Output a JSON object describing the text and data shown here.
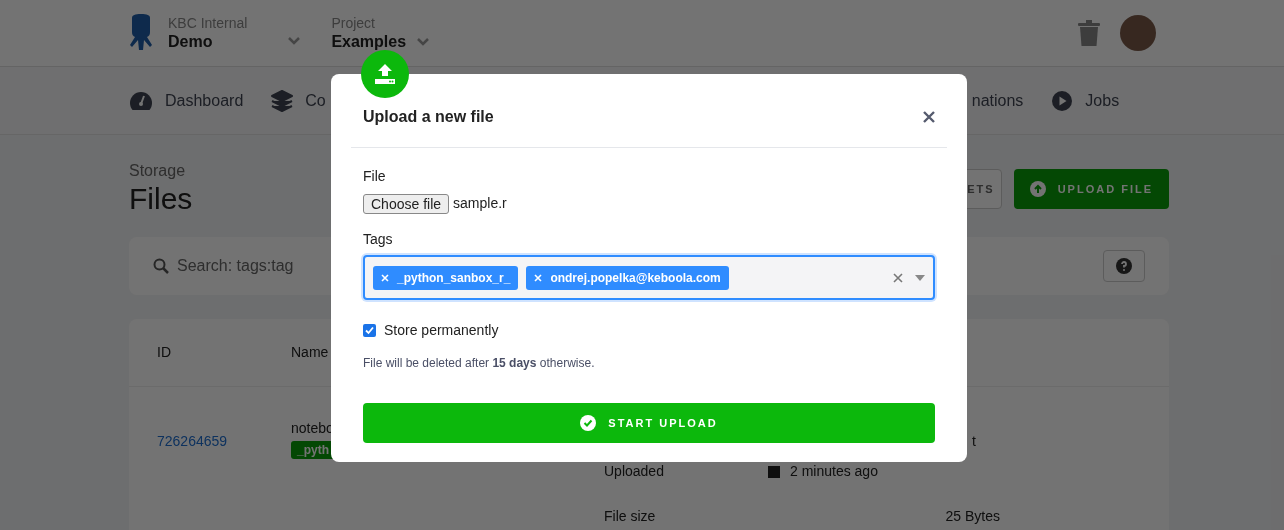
{
  "header": {
    "org_label": "KBC Internal",
    "org_name": "Demo",
    "project_label": "Project",
    "project_name": "Examples"
  },
  "nav": [
    {
      "kind": "gauge",
      "label": "Dashboard"
    },
    {
      "kind": "layers",
      "label": "Co"
    },
    {
      "kind": "none",
      "label": "nations"
    },
    {
      "kind": "play",
      "label": "Jobs"
    }
  ],
  "page": {
    "breadcrumb": "Storage",
    "title": "Files"
  },
  "actions": [
    {
      "kind": "outline",
      "label": "ETS"
    },
    {
      "kind": "primary",
      "label": "UPLOAD FILE"
    }
  ],
  "search": {
    "placeholder": "Search: tags:tag"
  },
  "table": {
    "columns": [
      "ID",
      "Name"
    ],
    "rows": [
      {
        "id": "726264659",
        "name": "notebo",
        "tag": "_pyth",
        "column_5": "t",
        "details": [
          {
            "label": "Uploaded",
            "value": "2 minutes ago"
          },
          {
            "label": "File size",
            "value": "25 Bytes"
          }
        ]
      }
    ]
  },
  "modal": {
    "title": "Upload a new file",
    "file_label": "File",
    "file_button": "Choose file",
    "file_name": "sample.r",
    "tags_label": "Tags",
    "tags": [
      "_python_sanbox_r_",
      "ondrej.popelka@keboola.com"
    ],
    "store_permanently": {
      "label": "Store permanently",
      "checked": true
    },
    "note": "File will be deleted after **15 days** otherwise.",
    "submit": "START UPLOAD"
  }
}
